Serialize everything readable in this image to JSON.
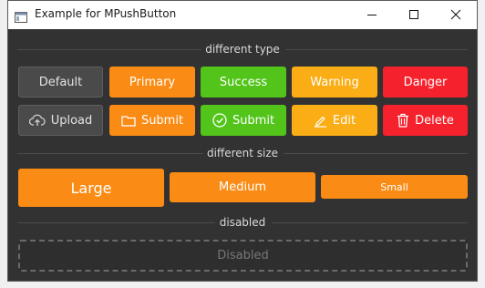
{
  "window": {
    "title": "Example for MPushButton",
    "controls": [
      "minimize-icon",
      "maximize-icon",
      "close-icon"
    ]
  },
  "sections": {
    "type_label": "different type",
    "size_label": "different size",
    "disabled_label": "disabled"
  },
  "type_row": [
    {
      "label": "Default",
      "variant": "default"
    },
    {
      "label": "Primary",
      "variant": "primary"
    },
    {
      "label": "Success",
      "variant": "success"
    },
    {
      "label": "Warning",
      "variant": "warning"
    },
    {
      "label": "Danger",
      "variant": "danger"
    }
  ],
  "icon_row": [
    {
      "label": "Upload",
      "variant": "default",
      "icon": "cloud-upload-icon"
    },
    {
      "label": "Submit",
      "variant": "primary",
      "icon": "folder-icon"
    },
    {
      "label": "Submit",
      "variant": "success",
      "icon": "check-circle-icon"
    },
    {
      "label": "Edit",
      "variant": "warning",
      "icon": "edit-icon"
    },
    {
      "label": "Delete",
      "variant": "danger",
      "icon": "trash-icon"
    }
  ],
  "size_row": [
    {
      "label": "Large",
      "size": "large"
    },
    {
      "label": "Medium",
      "size": "medium"
    },
    {
      "label": "Small",
      "size": "small"
    }
  ],
  "disabled_button": {
    "label": "Disabled"
  },
  "colors": {
    "default": "#4a4a4a",
    "primary": "#fa8c16",
    "success": "#52c41a",
    "warning": "#faad14",
    "danger": "#f5222d",
    "background": "#323232"
  }
}
